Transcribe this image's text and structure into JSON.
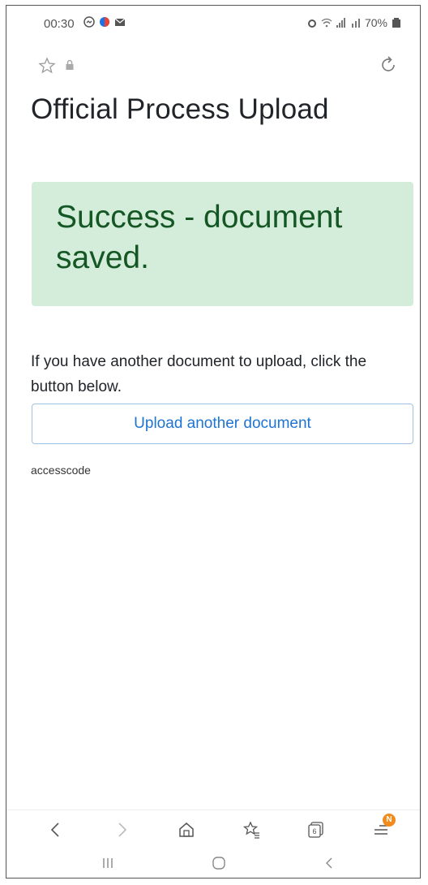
{
  "status_bar": {
    "time": "00:30",
    "battery": "70%"
  },
  "icons": {
    "star": "star-outline-icon",
    "lock": "lock-icon",
    "reload": "reload-icon",
    "back": "chevron-left-icon",
    "forward": "chevron-right-icon",
    "home": "home-icon",
    "bookmarks": "bookmark-star-icon",
    "tabs": "tabs-icon",
    "menu": "menu-icon"
  },
  "page": {
    "title": "Official Process Upload",
    "alert": "Success - document saved.",
    "info_text": "If you have another document to upload, click the button below.",
    "upload_button_label": "Upload another document",
    "access_label": "accesscode"
  },
  "toolbar": {
    "tabs_count": "6",
    "menu_badge": "N"
  },
  "colors": {
    "alert_bg": "#d4edda",
    "alert_text": "#155724",
    "link_blue": "#1e74d2",
    "badge_orange": "#f28b1b"
  }
}
